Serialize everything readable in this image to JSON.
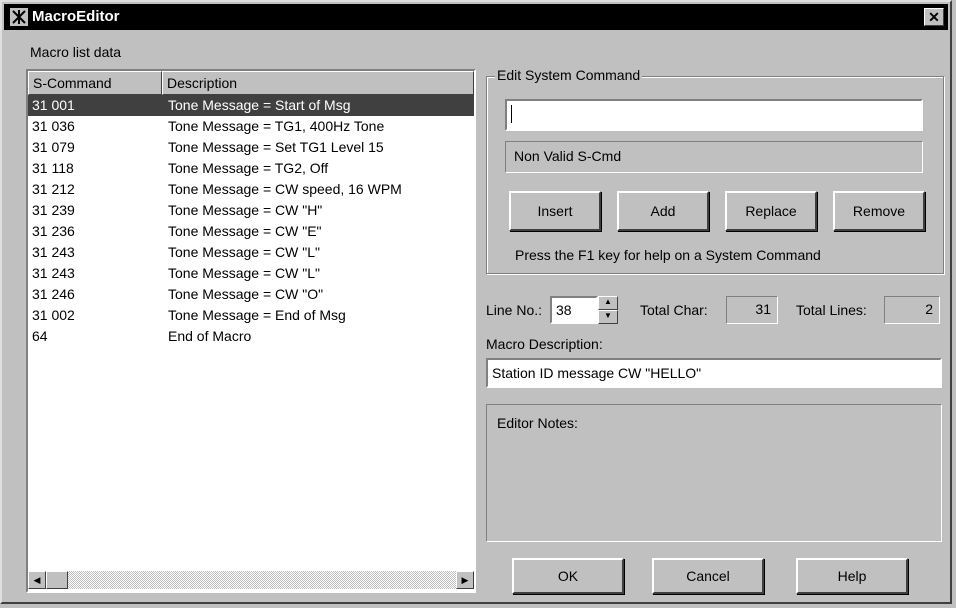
{
  "window": {
    "title": "MacroEditor",
    "close_label": "✕"
  },
  "list_group_label": "Macro list data",
  "list": {
    "headers": [
      "S-Command",
      "Description"
    ],
    "rows": [
      {
        "cmd": "31 001",
        "desc": "Tone Message = Start of Msg",
        "selected": true
      },
      {
        "cmd": "31 036",
        "desc": "Tone Message = TG1, 400Hz Tone"
      },
      {
        "cmd": "31 079",
        "desc": "Tone Message = Set TG1 Level 15"
      },
      {
        "cmd": "31 118",
        "desc": "Tone Message = TG2, Off"
      },
      {
        "cmd": "31 212",
        "desc": "Tone Message = CW speed, 16 WPM"
      },
      {
        "cmd": "31 239",
        "desc": "Tone Message = CW \"H\""
      },
      {
        "cmd": "31 236",
        "desc": "Tone Message = CW \"E\""
      },
      {
        "cmd": "31 243",
        "desc": "Tone Message = CW \"L\""
      },
      {
        "cmd": "31 243",
        "desc": "Tone Message = CW \"L\""
      },
      {
        "cmd": "31 246",
        "desc": "Tone Message = CW \"O\""
      },
      {
        "cmd": "31 002",
        "desc": "Tone Message = End of Msg"
      },
      {
        "cmd": "64",
        "desc": "End of Macro"
      }
    ]
  },
  "edit_group": {
    "title": "Edit System Command",
    "command_value": "",
    "status": "Non Valid S-Cmd",
    "buttons": {
      "insert": "Insert",
      "add": "Add",
      "replace": "Replace",
      "remove": "Remove"
    },
    "help_text": "Press the F1 key for help on a System Command"
  },
  "line_no": {
    "label": "Line No.:",
    "value": "38"
  },
  "total_char": {
    "label": "Total Char:",
    "value": "31"
  },
  "total_lines": {
    "label": "Total Lines:",
    "value": "2"
  },
  "macro_description": {
    "label": "Macro Description:",
    "value": "Station ID message CW \"HELLO\""
  },
  "editor_notes": {
    "label": "Editor Notes:"
  },
  "dialog_buttons": {
    "ok": "OK",
    "cancel": "Cancel",
    "help": "Help"
  }
}
